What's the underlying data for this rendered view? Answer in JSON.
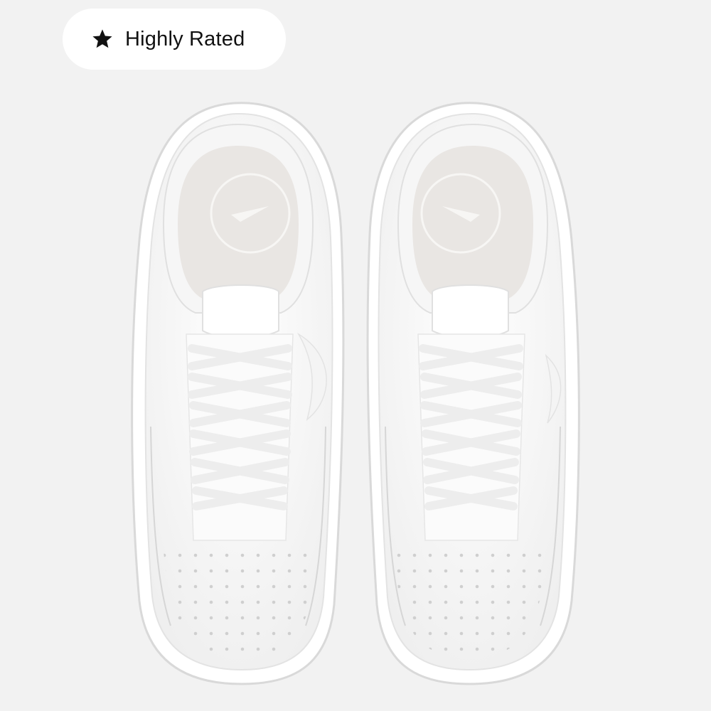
{
  "badge": {
    "label": "Highly Rated",
    "icon": "star-icon"
  },
  "product_image": {
    "icon": "sneaker-pair-image",
    "colors": {
      "background": "#f2f2f2",
      "upper": "#ffffff",
      "insole": "#e9e6e3",
      "shadow": "#dedede"
    }
  }
}
